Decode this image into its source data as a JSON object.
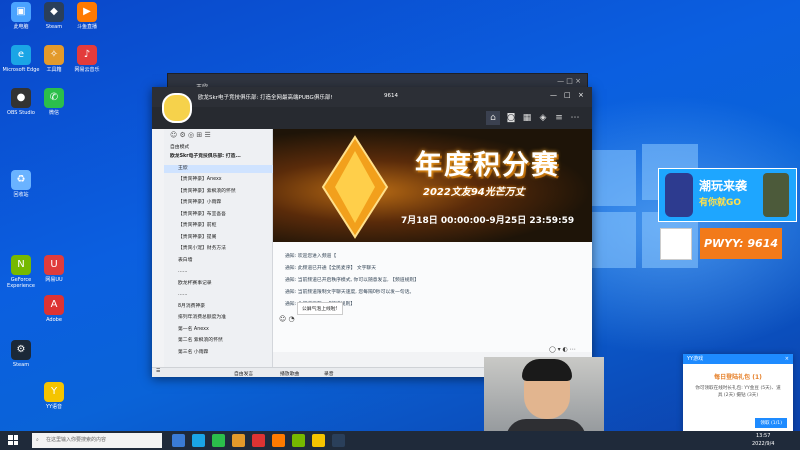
{
  "desktop_icons": [
    {
      "label": "此电脑",
      "icon": "computer-icon",
      "color": "#4aa3ff"
    },
    {
      "label": "Steam",
      "icon": "steam-icon",
      "color": "#2a3f5a"
    },
    {
      "label": "斗鱼直播",
      "icon": "douyu-icon",
      "color": "#ff7a00"
    },
    {
      "label": "Microsoft Edge",
      "icon": "edge-icon",
      "color": "#1aa5e6"
    },
    {
      "label": "工具箱",
      "icon": "toolbox-icon",
      "color": "#e39a2b"
    },
    {
      "label": "网易云音乐",
      "icon": "music-icon",
      "color": "#e33b3b"
    },
    {
      "label": "OBS Studio",
      "icon": "obs-icon",
      "color": "#333"
    },
    {
      "label": "微信",
      "icon": "wechat-icon",
      "color": "#2bbf4b"
    },
    {
      "label": "回收站",
      "icon": "recycle-bin-icon",
      "color": "#6ab3ff"
    },
    {
      "label": "GeForce Experience",
      "icon": "nvidia-icon",
      "color": "#76b900"
    },
    {
      "label": "网易UU",
      "icon": "uu-icon",
      "color": "#e03c3c"
    },
    {
      "label": "Adobe",
      "icon": "adobe-icon",
      "color": "#d33"
    },
    {
      "label": "Steam",
      "icon": "steam-icon-2",
      "color": "#1b2838"
    },
    {
      "label": "YY语音",
      "icon": "yy-icon",
      "color": "#f5c400"
    }
  ],
  "back_window": {
    "title": "王欣"
  },
  "main_window": {
    "channel_title": "欧龙Skr电子竞技俱乐部: 打造全网最高端PUBG俱乐部!",
    "channel_id": "9614",
    "window_controls": [
      "—",
      "□",
      "×"
    ],
    "sidebar_mode": "自由模式",
    "sidebar_rows": [
      "欧龙Skr电子竞技俱乐部: 打造...",
      "王欣",
      "【贵宾神豪】Anexx",
      "【贵宾神豪】紫枫浪的怀然",
      "【贵宾神豪】小雨霖",
      "【贵宾神豪】布宜吾吾",
      "【贵宾神豪】前枢",
      "【贵宾神豪】提阁",
      "【贵宾小宠】财务方法",
      "表白墙",
      "……",
      "欧龙杯赛事记录",
      "……",
      "8月消费神豪",
      "排列年消费总额度为准",
      "第一名 Anexx",
      "第二名 紫枫浪的怀然",
      "第三名 小雨霖"
    ],
    "banner": {
      "title": "年度积分赛",
      "subtitle": "2022文友94光芒万丈",
      "date_range": "7月18日 00:00:00-9月25日 23:59:59"
    },
    "chat_lines": [
      "通知: 欢迎您进入频道【",
      "通知: 此频道已开通【全民麦序】 文字聊天",
      "通知: 当前频道已开启秩序模式, 你可以随意发言, 【频道规则】",
      "通知: 当前频道限制文字聊天速度, 您每隔0秒可以发一句话。",
      "通知: 此频道正在...【频道规则】"
    ],
    "chat_popup": "公屏气泡上线啦!",
    "bottom_bar": {
      "mic": "自由发言",
      "record": "播放歌曲",
      "chat": "录音"
    }
  },
  "promo": {
    "title": "潮玩来袭",
    "subtitle": "有你就GO"
  },
  "pwyy_label": "PWYY: 9614",
  "notification": {
    "app": "YY游戏",
    "title": "每日登陆礼包 (1)",
    "body": "你可领取在线时长礼包: YY金豆 (5天)、道具 (2天) 摄钻 (3天)",
    "button": "领取 (1/1)"
  },
  "taskbar": {
    "search_placeholder": "在这里输入你要搜索的内容",
    "time": "13:57",
    "date": "2022/9/4"
  }
}
